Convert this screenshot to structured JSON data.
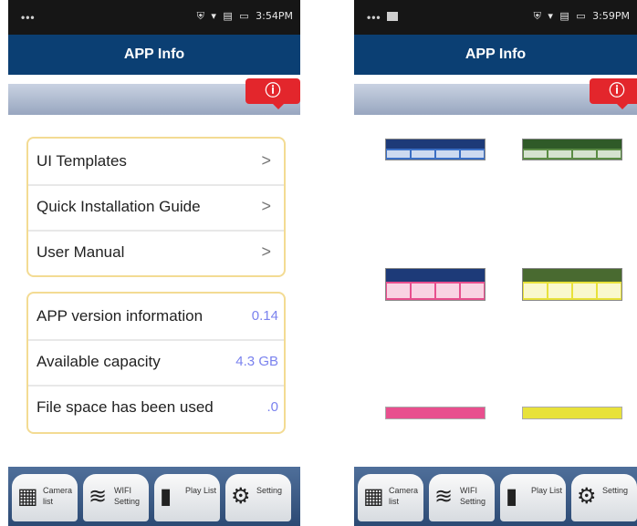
{
  "left_screen": {
    "status": {
      "dots": "•••",
      "icons": [
        "⛨",
        "▾",
        "▤",
        "▭"
      ],
      "time": "3:54PM"
    },
    "title": "APP Info",
    "info_badge": "ⓘ",
    "menu": [
      {
        "label": "UI Templates",
        "chevron": ">"
      },
      {
        "label": "Quick Installation Guide",
        "chevron": ">"
      },
      {
        "label": "User Manual",
        "chevron": ">"
      }
    ],
    "info": [
      {
        "label": "APP version information",
        "value": "0.14"
      },
      {
        "label": "Available capacity",
        "value": "4.3 GB"
      },
      {
        "label": "File space has been used",
        "value": ".0"
      }
    ],
    "tabs": [
      {
        "icon": "camera-list-icon",
        "glyph": "▦",
        "label": "Camera list"
      },
      {
        "icon": "wifi-icon",
        "glyph": "≋",
        "label": "WIFI Setting"
      },
      {
        "icon": "play-list-icon",
        "glyph": "▮",
        "label": "Play List"
      },
      {
        "icon": "gear-icon",
        "glyph": "⚙",
        "label": "Setting"
      }
    ]
  },
  "right_screen": {
    "status": {
      "dots": "•••",
      "icons": [
        "⛨",
        "▾",
        "▤",
        "▭"
      ],
      "time": "3:59PM"
    },
    "title": "APP Info",
    "info_badge": "ⓘ",
    "templates": [
      {
        "header": "#1d3a78",
        "footer": "#3a6ec4"
      },
      {
        "header": "#2f5a28",
        "footer": "#5a8b44"
      },
      {
        "header": "#1d3a78",
        "footer": "#e84f8e"
      },
      {
        "header": "#496a30",
        "footer": "#e8e23a"
      },
      {
        "header": "#e84f8e",
        "footer": "#e84f8e"
      },
      {
        "header": "#e8e23a",
        "footer": "#e8e23a"
      }
    ],
    "tabs": [
      {
        "icon": "camera-list-icon",
        "glyph": "▦",
        "label": "Camera list"
      },
      {
        "icon": "wifi-icon",
        "glyph": "≋",
        "label": "WIFI Setting"
      },
      {
        "icon": "play-list-icon",
        "glyph": "▮",
        "label": "Play List"
      },
      {
        "icon": "gear-icon",
        "glyph": "⚙",
        "label": "Setting"
      }
    ]
  }
}
